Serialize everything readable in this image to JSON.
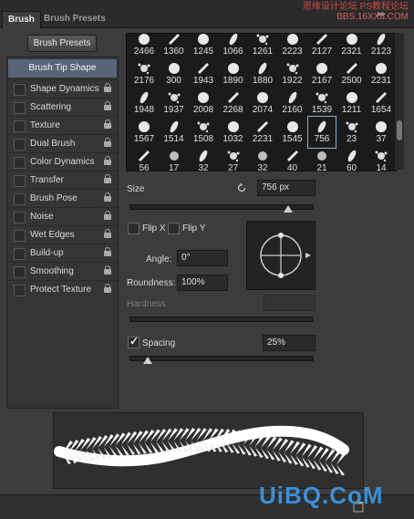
{
  "tabs": [
    {
      "label": "Brush",
      "active": true
    },
    {
      "label": "Brush Presets",
      "active": false
    }
  ],
  "collapse_icon": "double-chevron-icon",
  "watermark_top": {
    "line1": "思缘设计论坛",
    "line2": "PS教程论坛",
    "line3": "BBS.16XX8.COM"
  },
  "brush_presets_button": "Brush Presets",
  "tip_shape": {
    "label": "Brush Tip Shape"
  },
  "options": [
    {
      "label": "Shape Dynamics",
      "checked": false,
      "lock": true
    },
    {
      "label": "Scattering",
      "checked": false,
      "lock": true
    },
    {
      "label": "Texture",
      "checked": false,
      "lock": true
    },
    {
      "label": "Dual Brush",
      "checked": false,
      "lock": true
    },
    {
      "label": "Color Dynamics",
      "checked": false,
      "lock": true
    },
    {
      "label": "Transfer",
      "checked": false,
      "lock": true
    },
    {
      "label": "Brush Pose",
      "checked": false,
      "lock": true
    },
    {
      "label": "Noise",
      "checked": false,
      "lock": true
    },
    {
      "label": "Wet Edges",
      "checked": false,
      "lock": true
    },
    {
      "label": "Build-up",
      "checked": false,
      "lock": true
    },
    {
      "label": "Smoothing",
      "checked": false,
      "lock": true
    },
    {
      "label": "Protect Texture",
      "checked": false,
      "lock": true
    }
  ],
  "brush_grid": {
    "rows": [
      [
        "2466",
        "1360",
        "1245",
        "1066",
        "1261",
        "2223",
        "2127",
        "2321",
        "2123"
      ],
      [
        "2176",
        "300",
        "1943",
        "1890",
        "1880",
        "1922",
        "2167",
        "2500",
        "2231"
      ],
      [
        "1948",
        "1937",
        "2008",
        "2268",
        "2074",
        "2160",
        "1539",
        "1211",
        "1654"
      ],
      [
        "1567",
        "1514",
        "1508",
        "1032",
        "2231",
        "1545",
        "756",
        "23",
        "37"
      ],
      [
        "56",
        "17",
        "32",
        "27",
        "32",
        "40",
        "21",
        "60",
        "14"
      ]
    ],
    "selected": "756"
  },
  "size": {
    "label": "Size",
    "value": "756 px",
    "slider_fraction": 0.87,
    "reset_icon": "reset-icon"
  },
  "flip_x": {
    "label": "Flip X",
    "checked": false
  },
  "flip_y": {
    "label": "Flip Y",
    "checked": false
  },
  "angle": {
    "label": "Angle:",
    "value": "0°"
  },
  "roundness": {
    "label": "Roundness:",
    "value": "100%"
  },
  "hardness": {
    "label": "Hardness",
    "value": ""
  },
  "spacing": {
    "label": "Spacing",
    "checked": true,
    "value": "25%",
    "slider_fraction": 0.1
  },
  "watermark_bottom": "UiBQ.CoM",
  "accent_color": "#5a6478"
}
